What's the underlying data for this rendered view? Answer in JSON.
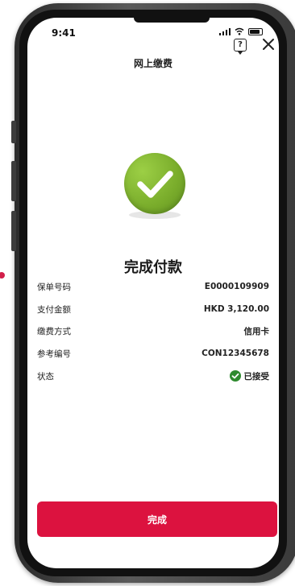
{
  "status_bar": {
    "time": "9:41"
  },
  "header": {
    "title": "网上缴费",
    "help_icon": "help-question-icon",
    "close_icon": "close-icon"
  },
  "result": {
    "icon": "success-check-icon",
    "title": "完成付款"
  },
  "details": [
    {
      "label": "保单号码",
      "value": "E0000109909"
    },
    {
      "label": "支付金额",
      "value": "HKD 3,120.00"
    },
    {
      "label": "缴费方式",
      "value": "信用卡"
    },
    {
      "label": "参考编号",
      "value": "CON12345678"
    },
    {
      "label": "状态",
      "value": "已接受"
    }
  ],
  "actions": {
    "done_label": "完成"
  },
  "colors": {
    "accent": "#dc123f",
    "success_green": "#79ac2b",
    "status_green": "#2e8a2e"
  }
}
